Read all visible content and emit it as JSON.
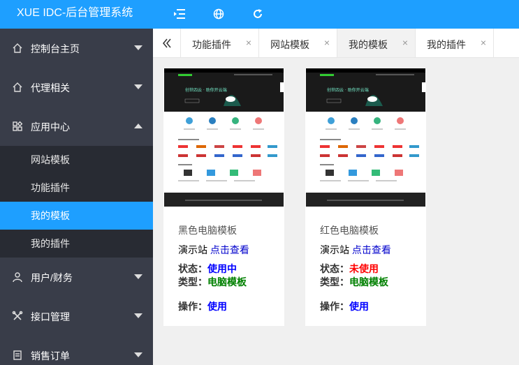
{
  "header": {
    "title": "XUE IDC-后台管理系统",
    "icons": [
      "menu-toggle-icon",
      "globe-icon",
      "refresh-icon"
    ]
  },
  "sidebar": {
    "items": [
      {
        "label": "控制台主页",
        "icon": "home-icon",
        "expanded": false
      },
      {
        "label": "代理相关",
        "icon": "home-icon",
        "expanded": false
      },
      {
        "label": "应用中心",
        "icon": "apps-icon",
        "expanded": true
      },
      {
        "label": "用户/财务",
        "icon": "user-icon",
        "expanded": false
      },
      {
        "label": "接口管理",
        "icon": "tools-icon",
        "expanded": false
      },
      {
        "label": "销售订单",
        "icon": "order-icon",
        "expanded": false
      }
    ],
    "subitems": [
      {
        "label": "网站模板",
        "active": false
      },
      {
        "label": "功能插件",
        "active": false
      },
      {
        "label": "我的模板",
        "active": true
      },
      {
        "label": "我的插件",
        "active": false
      }
    ]
  },
  "tabs": [
    {
      "label": "功能插件",
      "active": false
    },
    {
      "label": "网站模板",
      "active": false
    },
    {
      "label": "我的模板",
      "active": true
    },
    {
      "label": "我的插件",
      "active": false
    }
  ],
  "tab_close": "×",
  "cards": [
    {
      "title": "黑色电脑模板",
      "demo_label": "演示站",
      "demo_link": "点击查看",
      "status_label": "状态：",
      "status_value": "使用中",
      "type_label": "类型：",
      "type_value": "电脑模板",
      "action_label": "操作：",
      "action_value": "使用"
    },
    {
      "title": "红色电脑模板",
      "demo_label": "演示站",
      "demo_link": "点击查看",
      "status_label": "状态：",
      "status_value": "未使用",
      "type_label": "类型：",
      "type_value": "电脑模板",
      "action_label": "操作：",
      "action_value": "使用"
    }
  ],
  "colors": {
    "accent": "#1e9fff",
    "sidebar_bg": "#393d49",
    "status_in_use": "#0000ff",
    "status_unused": "#ff0000",
    "type": "#008000"
  }
}
